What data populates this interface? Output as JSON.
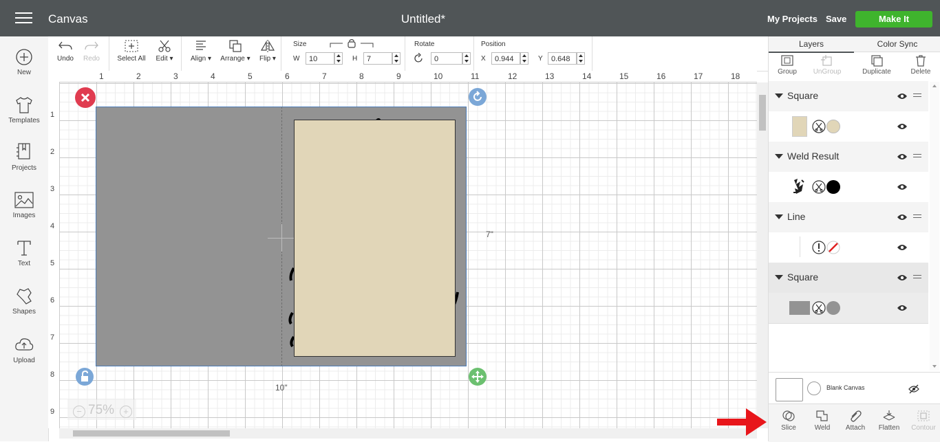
{
  "header": {
    "app_title": "Canvas",
    "doc_title": "Untitled*",
    "my_projects": "My Projects",
    "save": "Save",
    "make_it": "Make It",
    "make_it_color": "#3fb42d"
  },
  "leftbar": {
    "items": [
      {
        "label": "New",
        "icon": "plus-circle-icon"
      },
      {
        "label": "Templates",
        "icon": "tshirt-icon"
      },
      {
        "label": "Projects",
        "icon": "projects-icon"
      },
      {
        "label": "Images",
        "icon": "image-icon"
      },
      {
        "label": "Text",
        "icon": "text-icon"
      },
      {
        "label": "Shapes",
        "icon": "shapes-icon"
      },
      {
        "label": "Upload",
        "icon": "upload-cloud-icon"
      }
    ]
  },
  "toolbar": {
    "undo": "Undo",
    "redo": "Redo",
    "select_all": "Select All",
    "edit": "Edit",
    "align": "Align",
    "arrange": "Arrange",
    "flip": "Flip",
    "size_label": "Size",
    "w_label": "W",
    "w_value": "10",
    "h_label": "H",
    "h_value": "7",
    "rotate_label": "Rotate",
    "rotate_value": "0",
    "position_label": "Position",
    "x_label": "X",
    "x_value": "0.944",
    "y_label": "Y",
    "y_value": "0.648"
  },
  "canvas": {
    "ruler_top": [
      "1",
      "2",
      "3",
      "4",
      "5",
      "6",
      "7",
      "8",
      "9",
      "10",
      "11",
      "12",
      "13",
      "14",
      "15",
      "16",
      "17",
      "18"
    ],
    "ruler_left": [
      "1",
      "2",
      "3",
      "4",
      "5",
      "6",
      "7",
      "8",
      "9"
    ],
    "width_dim": "10\"",
    "height_dim": "7\"",
    "zoom": "75%",
    "gray_color": "#939393",
    "cream_color": "#e1d6b8"
  },
  "rightpanel": {
    "tabs": [
      "Layers",
      "Color Sync"
    ],
    "layer_tools": [
      "Group",
      "UnGroup",
      "Duplicate",
      "Delete"
    ],
    "layers": [
      {
        "name": "Square"
      },
      {
        "name": "Weld Result"
      },
      {
        "name": "Line"
      },
      {
        "name": "Square"
      }
    ],
    "blank_canvas": "Blank Canvas",
    "actions": [
      "Slice",
      "Weld",
      "Attach",
      "Flatten",
      "Contour"
    ]
  }
}
